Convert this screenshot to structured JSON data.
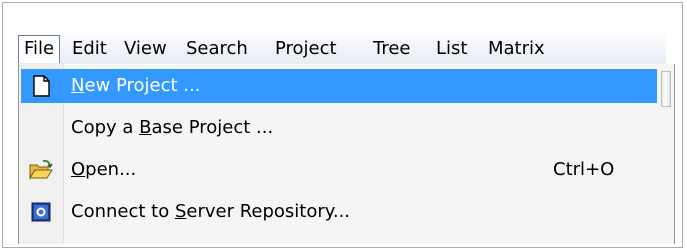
{
  "menubar": {
    "items": [
      "File",
      "Edit",
      "View",
      "Search",
      "Project",
      "Tree",
      "List",
      "Matrix"
    ]
  },
  "file_menu": {
    "items": [
      {
        "label_pre": "",
        "accel": "N",
        "label_post": "ew Project ...",
        "shortcut": "",
        "icon": "new-document-icon",
        "highlighted": true
      },
      {
        "label_pre": "Copy a ",
        "accel": "B",
        "label_post": "ase Project ...",
        "shortcut": "",
        "icon": "",
        "highlighted": false
      },
      {
        "label_pre": "",
        "accel": "O",
        "label_post": "pen...",
        "shortcut": "Ctrl+O",
        "icon": "open-folder-icon",
        "highlighted": false
      },
      {
        "label_pre": "Connect to ",
        "accel": "S",
        "label_post": "erver Repository...",
        "shortcut": "",
        "icon": "server-repository-icon",
        "highlighted": false
      }
    ]
  },
  "colors": {
    "highlight": "#3399ff",
    "menubar_top": "#fbfcfe",
    "menubar_bottom": "#e6ebf3"
  }
}
